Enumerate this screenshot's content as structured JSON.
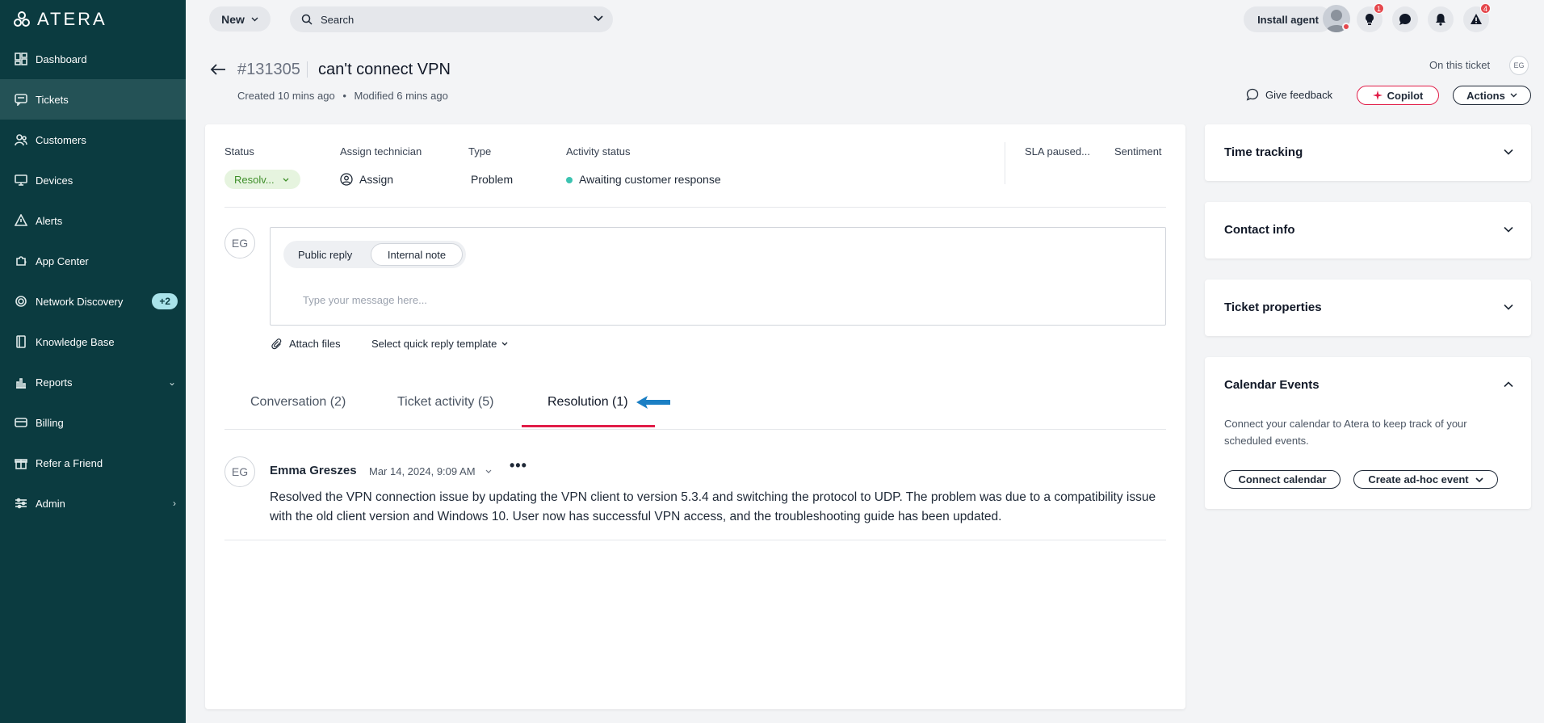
{
  "app": {
    "logo_text": "ATERA"
  },
  "sidebar": {
    "items": [
      {
        "label": "Dashboard",
        "icon": "dashboard-icon"
      },
      {
        "label": "Tickets",
        "icon": "tickets-icon",
        "active": true
      },
      {
        "label": "Customers",
        "icon": "customers-icon"
      },
      {
        "label": "Devices",
        "icon": "devices-icon"
      },
      {
        "label": "Alerts",
        "icon": "alerts-icon"
      },
      {
        "label": "App Center",
        "icon": "app-center-icon"
      },
      {
        "label": "Network Discovery",
        "icon": "network-icon",
        "badge": "+2"
      },
      {
        "label": "Knowledge Base",
        "icon": "book-icon"
      },
      {
        "label": "Reports",
        "icon": "reports-icon",
        "caret": "down"
      },
      {
        "label": "Billing",
        "icon": "billing-icon"
      },
      {
        "label": "Refer a Friend",
        "icon": "gift-icon"
      },
      {
        "label": "Admin",
        "icon": "admin-icon",
        "caret": "right"
      }
    ]
  },
  "topbar": {
    "new_label": "New",
    "search_placeholder": "Search",
    "install_label": "Install agent",
    "tips_badge": "1",
    "alerts_badge": "4"
  },
  "ticket": {
    "id": "#131305",
    "title": "can't connect VPN",
    "created": "Created 10 mins ago",
    "separator": "•",
    "modified": "Modified 6 mins ago",
    "on_this_ticket": "On this ticket",
    "viewer_initials": "EG"
  },
  "header_actions": {
    "feedback": "Give feedback",
    "copilot": "Copilot",
    "actions": "Actions"
  },
  "fields": {
    "status_label": "Status",
    "status_value": "Resolv...",
    "tech_label": "Assign technician",
    "tech_value": "Assign",
    "type_label": "Type",
    "type_value": "Problem",
    "activity_label": "Activity status",
    "activity_value": "Awaiting customer response",
    "sla_label": "SLA paused...",
    "sentiment_label": "Sentiment"
  },
  "reply": {
    "avatar": "EG",
    "public_label": "Public reply",
    "internal_label": "Internal note",
    "placeholder": "Type your message here...",
    "attach_label": "Attach files",
    "template_label": "Select quick reply template"
  },
  "tabs": [
    {
      "label": "Conversation (2)"
    },
    {
      "label": "Ticket activity (5)"
    },
    {
      "label": "Resolution (1)",
      "active": true
    }
  ],
  "entry": {
    "avatar": "EG",
    "author": "Emma Greszes",
    "date": "Mar 14, 2024, 9:09 AM",
    "more": "•••",
    "body": "Resolved the VPN connection issue by updating the VPN client to version 5.3.4 and switching the protocol to UDP. The problem was due to a compatibility issue with the old client version and Windows 10. User now has successful VPN access, and the troubleshooting guide has been updated."
  },
  "panels": {
    "time_tracking": "Time tracking",
    "contact_info": "Contact info",
    "ticket_properties": "Ticket properties",
    "calendar_title": "Calendar Events",
    "calendar_desc": "Connect your calendar to Atera to keep track of your scheduled events.",
    "connect_label": "Connect calendar",
    "adhoc_label": "Create ad-hoc event"
  },
  "colors": {
    "sidebar_bg": "#0b3b40",
    "accent_pink": "#e11d48",
    "status_green": "#3f8f2a",
    "annotation_arrow": "#1b7fc4"
  }
}
